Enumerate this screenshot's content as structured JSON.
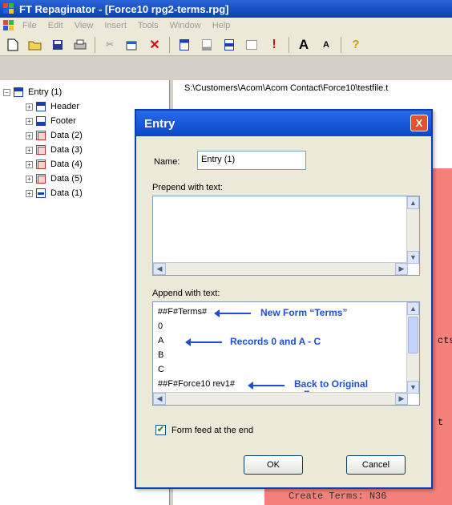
{
  "window": {
    "title": "FT Repaginator - [Force10 rpg2-terms.rpg]"
  },
  "menubar": {
    "items": [
      "File",
      "Edit",
      "View",
      "Insert",
      "Tools",
      "Window",
      "Help"
    ]
  },
  "toolbar": {
    "buttons": [
      "new-icon",
      "open-icon",
      "save-icon",
      "print-icon",
      "cut-icon",
      "properties-icon",
      "delete-icon",
      "header-icon",
      "footer-icon",
      "data-icon",
      "entry-icon",
      "exclamation-icon",
      "font-large-icon",
      "font-small-icon",
      "help-icon"
    ]
  },
  "tree": {
    "root": "Entry (1)",
    "children": [
      {
        "label": "Header",
        "icon": "header-icon"
      },
      {
        "label": "Footer",
        "icon": "footer-icon"
      },
      {
        "label": "Data (2)",
        "icon": "data-icon"
      },
      {
        "label": "Data (3)",
        "icon": "data-icon"
      },
      {
        "label": "Data (4)",
        "icon": "data-icon"
      },
      {
        "label": "Data (5)",
        "icon": "data-icon"
      },
      {
        "label": "Data (1)",
        "icon": "data-blue-icon"
      }
    ]
  },
  "document": {
    "path": "S:\\Customers\\Acom\\Acom Contact\\Force10\\testfile.t",
    "text_fragment_1": "cts",
    "text_fragment_2": "t",
    "text_fragment_3": "Create Terms: N36"
  },
  "dialog": {
    "title": "Entry",
    "close_label": "X",
    "name_label": "Name:",
    "name_value": "Entry (1)",
    "prepend_label": "Prepend with text:",
    "prepend_value": "",
    "append_label": "Append with text:",
    "append_lines": [
      "##F#Terms#",
      "0",
      "A",
      "B",
      "C",
      "##F#Force10 rev1#"
    ],
    "annotations": {
      "new_form": "New Form “Terms”",
      "records": "Records 0 and A - C",
      "back_line1": "Back to Original",
      "back_line2": "Form"
    },
    "form_feed_label": "Form feed at the end",
    "form_feed_checked": true,
    "ok_label": "OK",
    "cancel_label": "Cancel"
  },
  "colors": {
    "title_blue": "#0a3fb0",
    "annotation_blue": "#1f4fd0",
    "doc_pink": "#f4807a",
    "close_red": "#e0532e"
  }
}
